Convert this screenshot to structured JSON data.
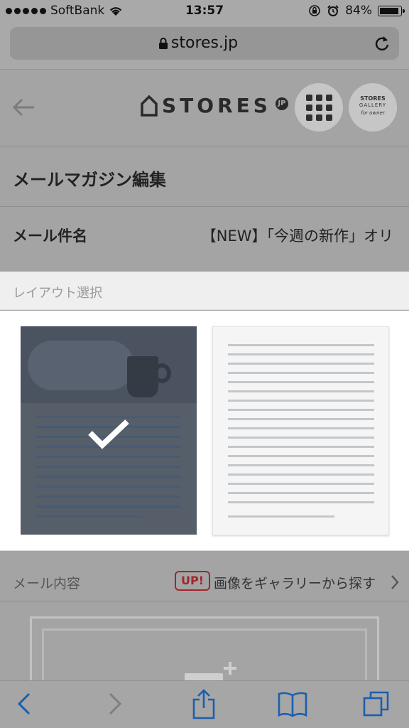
{
  "status_bar": {
    "carrier": "SoftBank",
    "time": "13:57",
    "battery": "84%"
  },
  "browser": {
    "url": "stores.jp"
  },
  "header": {
    "logo_text": "STORES",
    "logo_badge": "JP",
    "gallery_line1": "STORES",
    "gallery_line2": "GALLERY",
    "gallery_line3": "for owner"
  },
  "page": {
    "title": "メールマガジン編集"
  },
  "subject": {
    "label": "メール件名",
    "value": "【NEW】「今週の新作」オリ"
  },
  "layout": {
    "heading": "レイアウト選択",
    "selected_option": "image-with-text"
  },
  "content": {
    "heading": "メール内容",
    "badge": "UP!",
    "gallery_link": "画像をギャラリーから探す"
  },
  "colors": {
    "accent_red": "#a3262a",
    "selected_layout": "#555e69"
  }
}
